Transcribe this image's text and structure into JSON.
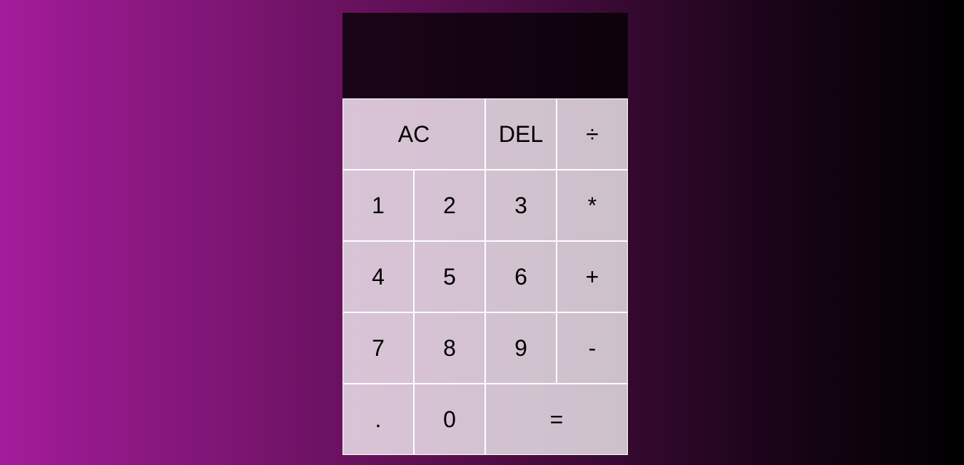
{
  "display": {
    "previous_operand": "",
    "current_operand": ""
  },
  "keys": {
    "all_clear": "AC",
    "delete": "DEL",
    "divide": "÷",
    "one": "1",
    "two": "2",
    "three": "3",
    "multiply": "*",
    "four": "4",
    "five": "5",
    "six": "6",
    "add": "+",
    "seven": "7",
    "eight": "8",
    "nine": "9",
    "subtract": "-",
    "decimal": ".",
    "zero": "0",
    "equals": "="
  },
  "colors": {
    "background_gradient_start": "#a31c9a",
    "background_gradient_end": "#000000",
    "display_background": "#1a0618",
    "key_background": "#d4c4d6",
    "key_border": "#ffffff",
    "key_text": "#000000"
  }
}
